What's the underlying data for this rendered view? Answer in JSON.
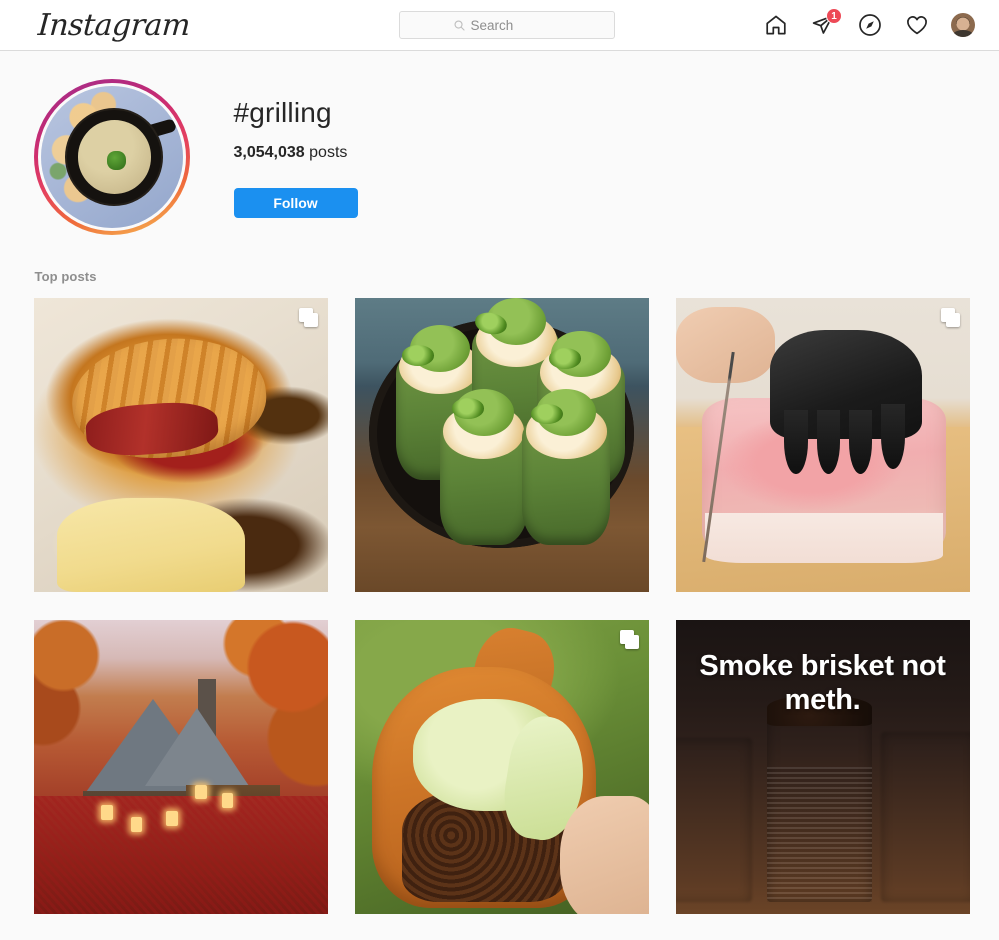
{
  "header": {
    "logo_text": "Instagram",
    "search": {
      "placeholder": "Search",
      "value": "",
      "icon": "search-icon"
    },
    "nav": [
      {
        "name": "home-icon",
        "label": "Home"
      },
      {
        "name": "direct-messages-icon",
        "label": "Messages",
        "badge": "1"
      },
      {
        "name": "explore-compass-icon",
        "label": "Explore"
      },
      {
        "name": "activity-heart-icon",
        "label": "Activity"
      },
      {
        "name": "profile-avatar",
        "label": "Profile"
      }
    ],
    "badge_count": "1"
  },
  "hashtag": {
    "avatar_name": "hashtag-avatar",
    "title": "#grilling",
    "post_count": "3,054,038",
    "post_count_unit": "posts",
    "follow_label": "Follow"
  },
  "section": {
    "top_posts_label": "Top posts"
  },
  "posts": [
    {
      "id": "post-1",
      "alt": "Bacon and melted cheese stuffed croissant on parchment paper",
      "carousel": true,
      "overlay_text": ""
    },
    {
      "id": "post-2",
      "alt": "Stuffed green peppers topped with guacamole and jalapeno slices in a cast iron skillet",
      "carousel": false,
      "overlay_text": ""
    },
    {
      "id": "post-3",
      "alt": "Gloved hand slicing a thick marbled wagyu steak on a wooden board",
      "carousel": true,
      "overlay_text": ""
    },
    {
      "id": "post-4",
      "alt": "A-frame cabin lit up in autumn woods with red and orange leaves",
      "carousel": false,
      "overlay_text": ""
    },
    {
      "id": "post-5",
      "alt": "Crispy cheese shell taco with ground beef and lettuce held in a hand over grass",
      "carousel": true,
      "overlay_text": ""
    },
    {
      "id": "post-6",
      "alt": "Sliced smoked brisket burnt ends with caption text",
      "carousel": false,
      "overlay_text": "Smoke brisket not meth."
    }
  ],
  "colors": {
    "follow_blue": "#1b90f0",
    "badge_red": "#ed4956",
    "page_bg": "#fafafa",
    "text_primary": "#262626",
    "text_secondary": "#8e8e8e",
    "border": "#dbdbdb"
  }
}
